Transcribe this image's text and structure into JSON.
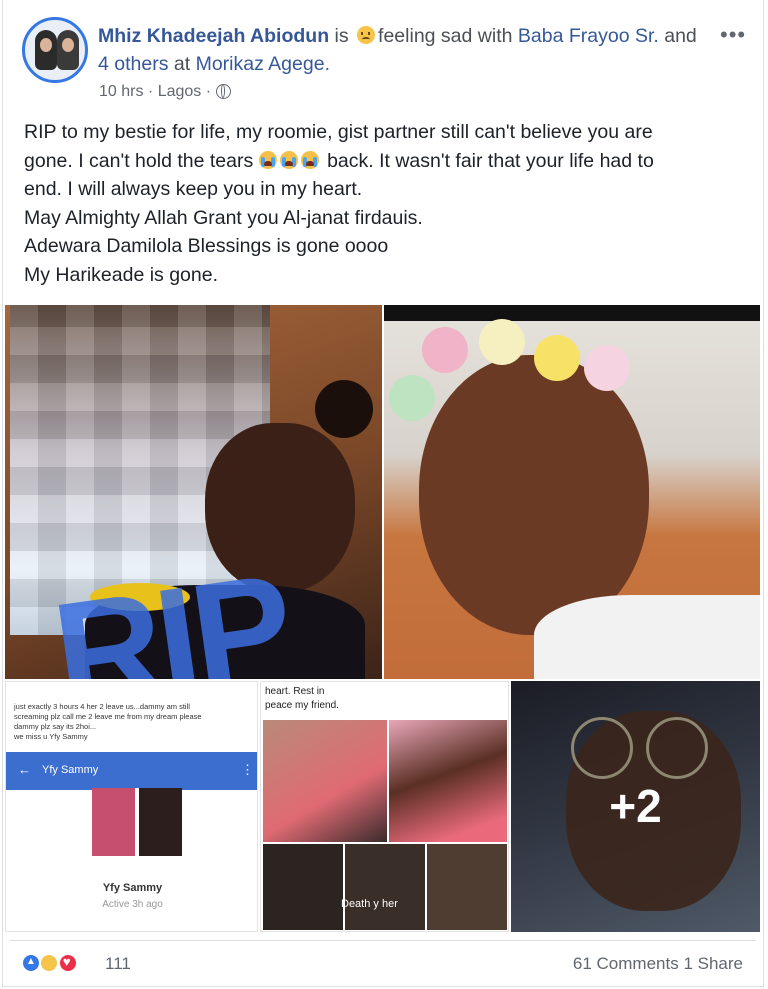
{
  "post": {
    "author": "Mhiz Khadeejah Abiodun",
    "is": "is",
    "feeling": "feeling sad with",
    "tagged": "Baba Frayoo Sr.",
    "and": "and",
    "others": "4 others",
    "at": "at",
    "place": "Morikaz Agege.",
    "time": "10 hrs",
    "location": "Lagos",
    "privacy_icon": "globe-icon",
    "more_label": "•••",
    "text_lines": [
      "RIP to my bestie for life, my roomie, gist partner still can't believe you are",
      "gone. I can't hold the tears",
      "back. It wasn't fair that your life had to",
      "end. I will always keep you in my heart.",
      "May Almighty Allah Grant you Al-janat firdauis.",
      "Adewara Damilola Blessings is gone oooo",
      "My Harikeade is gone."
    ],
    "photo1_overlay": "RIP",
    "screenshot": {
      "lines": [
        "just exactly 3 hours 4 her 2 leave us...dammy am still",
        "screaming plz call me 2 leave me from my dream please",
        "dammy plz say its 2hoi...",
        "we miss u Yfy Sammy"
      ],
      "bar_title": "Yfy Sammy",
      "name": "Yfy Sammy",
      "active": "Active 3h ago"
    },
    "collage": {
      "caption1": "heart. Rest in",
      "caption2": "peace my friend.",
      "overlay": "Death y",
      "overlay2": "her"
    },
    "more_photos": "+2",
    "reaction_count": "111",
    "comments": "61 Comments",
    "shares": "1 Share"
  },
  "colors": {
    "link": "#365899",
    "like_blue": "#3578e5",
    "love_red": "#ed2e4b",
    "text": "#1d2129",
    "meta": "#616770"
  }
}
